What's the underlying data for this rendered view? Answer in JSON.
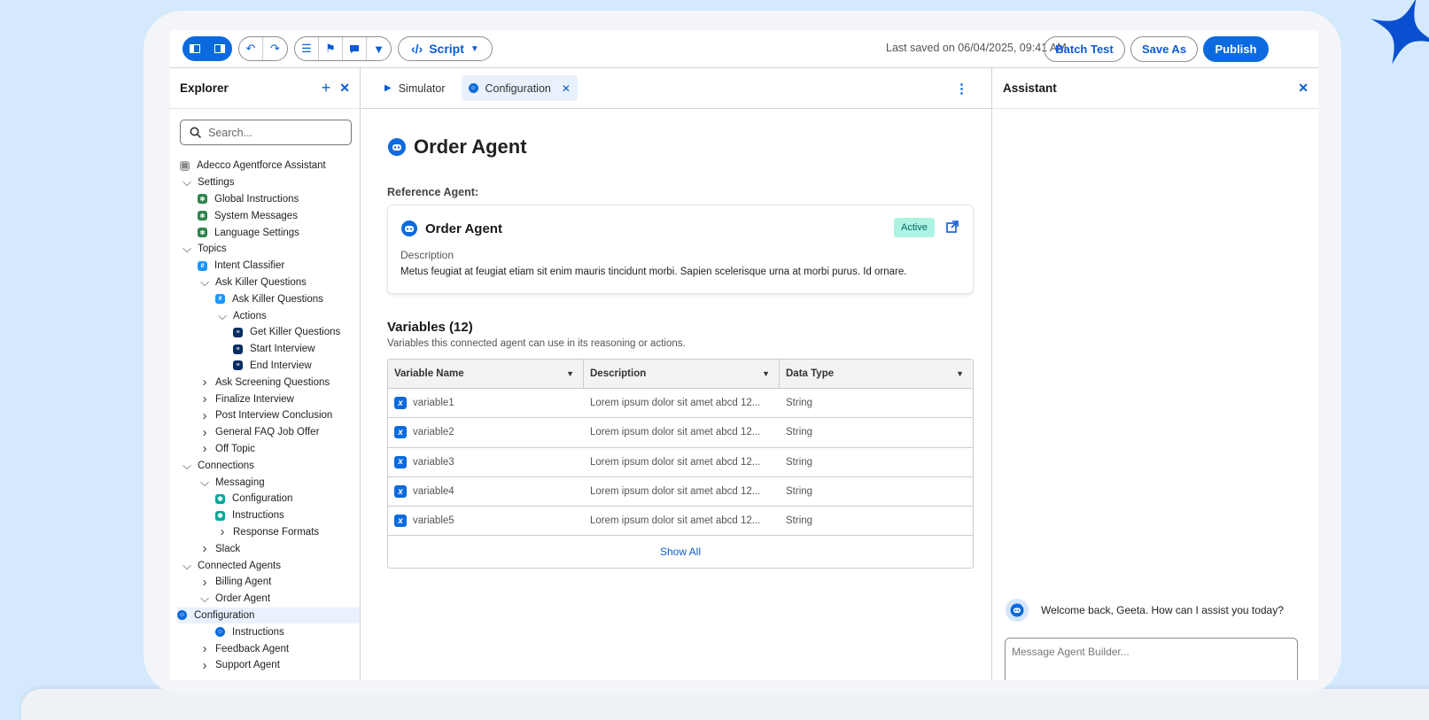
{
  "toolbar": {
    "script_label": "Script",
    "last_saved": "Last saved on 06/04/2025, 09:41 AM",
    "batch_test": "Batch Test",
    "save_as": "Save As",
    "publish": "Publish"
  },
  "explorer": {
    "title": "Explorer",
    "search_placeholder": "Search...",
    "tree": [
      {
        "label": "Adecco Agentforce Assistant",
        "level": 0,
        "chevron": "",
        "icon": "gray"
      },
      {
        "label": "Settings",
        "level": 0,
        "chevron": "down",
        "icon": ""
      },
      {
        "label": "Global Instructions",
        "level": 1,
        "chevron": "",
        "icon": "green"
      },
      {
        "label": "System Messages",
        "level": 1,
        "chevron": "",
        "icon": "green"
      },
      {
        "label": "Language Settings",
        "level": 1,
        "chevron": "",
        "icon": "green"
      },
      {
        "label": "Topics",
        "level": 0,
        "chevron": "down",
        "icon": ""
      },
      {
        "label": "Intent Classifier",
        "level": 1,
        "chevron": "",
        "icon": "blue"
      },
      {
        "label": "Ask Killer Questions",
        "level": 1,
        "chevron": "down",
        "icon": ""
      },
      {
        "label": "Ask Killer Questions",
        "level": 2,
        "chevron": "",
        "icon": "blue"
      },
      {
        "label": "Actions",
        "level": 2,
        "chevron": "down",
        "icon": ""
      },
      {
        "label": "Get Killer Questions",
        "level": 3,
        "chevron": "",
        "icon": "navy"
      },
      {
        "label": "Start Interview",
        "level": 3,
        "chevron": "",
        "icon": "navy"
      },
      {
        "label": "End Interview",
        "level": 3,
        "chevron": "",
        "icon": "navy"
      },
      {
        "label": "Ask Screening Questions",
        "level": 1,
        "chevron": "right",
        "icon": ""
      },
      {
        "label": "Finalize Interview",
        "level": 1,
        "chevron": "right",
        "icon": ""
      },
      {
        "label": "Post Interview Conclusion",
        "level": 1,
        "chevron": "right",
        "icon": ""
      },
      {
        "label": "General FAQ Job Offer",
        "level": 1,
        "chevron": "right",
        "icon": ""
      },
      {
        "label": "Off Topic",
        "level": 1,
        "chevron": "right",
        "icon": ""
      },
      {
        "label": "Connections",
        "level": 0,
        "chevron": "down",
        "icon": ""
      },
      {
        "label": "Messaging",
        "level": 1,
        "chevron": "down",
        "icon": ""
      },
      {
        "label": "Configuration",
        "level": 2,
        "chevron": "",
        "icon": "teal"
      },
      {
        "label": "Instructions",
        "level": 2,
        "chevron": "",
        "icon": "teal"
      },
      {
        "label": "Response Formats",
        "level": 2,
        "chevron": "right",
        "icon": ""
      },
      {
        "label": "Slack",
        "level": 1,
        "chevron": "right",
        "icon": ""
      },
      {
        "label": "Connected Agents",
        "level": 0,
        "chevron": "down",
        "icon": ""
      },
      {
        "label": "Billing Agent",
        "level": 1,
        "chevron": "right",
        "icon": ""
      },
      {
        "label": "Order Agent",
        "level": 1,
        "chevron": "down",
        "icon": ""
      },
      {
        "label": "Configuration",
        "level": 2,
        "chevron": "",
        "icon": "agent",
        "selected": true
      },
      {
        "label": "Instructions",
        "level": 2,
        "chevron": "",
        "icon": "agent"
      },
      {
        "label": "Feedback Agent",
        "level": 1,
        "chevron": "right",
        "icon": ""
      },
      {
        "label": "Support Agent",
        "level": 1,
        "chevron": "right",
        "icon": ""
      }
    ]
  },
  "tabs": {
    "simulator": "Simulator",
    "configuration": "Configuration"
  },
  "main": {
    "title": "Order Agent",
    "reference_label": "Reference Agent:",
    "card": {
      "name": "Order Agent",
      "status": "Active",
      "description_label": "Description",
      "description": "Metus feugiat at feugiat etiam sit enim mauris tincidunt morbi. Sapien scelerisque urna at morbi purus. Id ornare."
    },
    "variables_heading": "Variables (12)",
    "variables_sub": "Variables this connected agent can use in its reasoning or actions.",
    "columns": [
      "Variable Name",
      "Description",
      "Data Type"
    ],
    "rows": [
      {
        "name": "variable1",
        "description": "Lorem ipsum dolor sit amet abcd 12...",
        "type": "String"
      },
      {
        "name": "variable2",
        "description": "Lorem ipsum dolor sit amet abcd 12...",
        "type": "String"
      },
      {
        "name": "variable3",
        "description": "Lorem ipsum dolor sit amet abcd 12...",
        "type": "String"
      },
      {
        "name": "variable4",
        "description": "Lorem ipsum dolor sit amet abcd 12...",
        "type": "String"
      },
      {
        "name": "variable5",
        "description": "Lorem ipsum dolor sit amet abcd 12...",
        "type": "String"
      }
    ],
    "show_all": "Show All"
  },
  "assistant": {
    "title": "Assistant",
    "welcome": "Welcome back, Geeta. How can I assist you today?",
    "input_placeholder": "Message Agent Builder..."
  }
}
